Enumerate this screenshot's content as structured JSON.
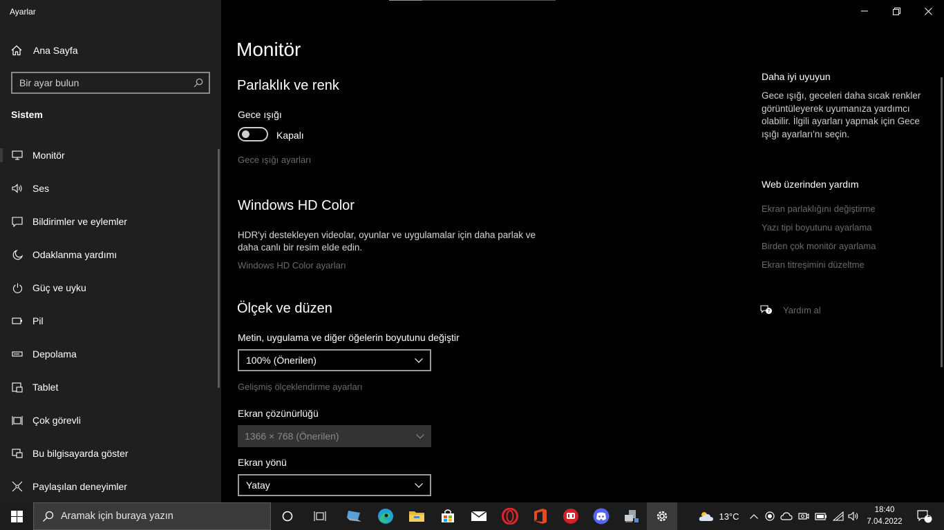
{
  "window": {
    "app_title": "Ayarlar",
    "controls": [
      "minimize",
      "restore",
      "close"
    ]
  },
  "sidebar": {
    "home_label": "Ana Sayfa",
    "search_placeholder": "Bir ayar bulun",
    "section_title": "Sistem",
    "items": [
      {
        "label": "Monitör",
        "icon": "monitor-icon",
        "active": true
      },
      {
        "label": "Ses",
        "icon": "speaker-icon"
      },
      {
        "label": "Bildirimler ve eylemler",
        "icon": "notification-icon"
      },
      {
        "label": "Odaklanma yardımı",
        "icon": "moon-icon"
      },
      {
        "label": "Güç ve uyku",
        "icon": "power-icon"
      },
      {
        "label": "Pil",
        "icon": "battery-icon"
      },
      {
        "label": "Depolama",
        "icon": "storage-icon"
      },
      {
        "label": "Tablet",
        "icon": "tablet-icon"
      },
      {
        "label": "Çok görevli",
        "icon": "multitask-icon"
      },
      {
        "label": "Bu bilgisayarda göster",
        "icon": "project-icon"
      },
      {
        "label": "Paylaşılan deneyimler",
        "icon": "shared-experiences-icon"
      }
    ]
  },
  "main": {
    "page_title": "Monitör",
    "brightness": {
      "heading": "Parlaklık ve renk",
      "night_light_label": "Gece ışığı",
      "night_light_state": "Kapalı",
      "night_light_on": false,
      "night_light_settings_link": "Gece ışığı ayarları"
    },
    "hdr": {
      "heading": "Windows HD Color",
      "description": "HDR'yi destekleyen videolar, oyunlar ve uygulamalar için daha parlak ve daha canlı bir resim elde edin.",
      "settings_link": "Windows HD Color ayarları"
    },
    "scale": {
      "heading": "Ölçek ve düzen",
      "size_label": "Metin, uygulama ve diğer öğelerin boyutunu değiştir",
      "size_value": "100% (Önerilen)",
      "advanced_link": "Gelişmiş ölçeklendirme ayarları",
      "resolution_label": "Ekran çözünürlüğü",
      "resolution_value": "1366 × 768 (Önerilen)",
      "orientation_label": "Ekran yönü",
      "orientation_value": "Yatay"
    }
  },
  "right": {
    "tip_title": "Daha iyi uyuyun",
    "tip_text": "Gece ışığı, geceleri daha sıcak renkler görüntüleyerek uyumanıza yardımcı olabilir. İlgili ayarları yapmak için Gece ışığı ayarları'nı seçin.",
    "web_help_title": "Web üzerinden yardım",
    "links": [
      "Ekran parlaklığını değiştirme",
      "Yazı tipi boyutunu ayarlama",
      "Birden çok monitör ayarlama",
      "Ekran titreşimini düzeltme"
    ],
    "get_help": "Yardım al"
  },
  "taskbar": {
    "search_placeholder": "Aramak için buraya yazın",
    "apps": [
      "cortana-icon",
      "task-view-icon",
      "laptop-app-icon",
      "edge-icon",
      "file-explorer-icon",
      "store-icon",
      "mail-icon",
      "opera-icon",
      "office-icon",
      "game-app-icon",
      "discord-icon",
      "network-app-icon",
      "settings-icon"
    ],
    "weather": "13°C",
    "time": "18:40",
    "date": "7.04.2022",
    "notification_count": "1"
  },
  "colors": {
    "sidebar_bg": "#1f1f1f",
    "main_bg": "#000000",
    "dim_link": "#6b6b6b",
    "taskbar_bg": "#1c1c1c"
  }
}
